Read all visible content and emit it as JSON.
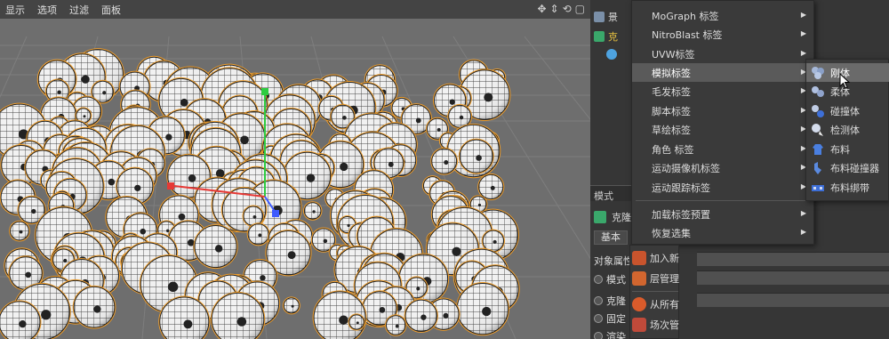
{
  "viewport": {
    "menu": [
      "显示",
      "选项",
      "过滤",
      "面板"
    ],
    "nav_icons": [
      "move-icon",
      "move-vertical-icon",
      "rotate-icon",
      "maximize-icon"
    ]
  },
  "object_manager": {
    "rows": [
      {
        "label": "景",
        "icon": "null-object-icon"
      },
      {
        "label": "克",
        "icon": "cloner-icon"
      },
      {
        "label": "",
        "icon": "sphere-icon"
      }
    ]
  },
  "attributes": {
    "title": "模式",
    "object_label": "克隆",
    "tab_basic": "基本",
    "section": "对象属性",
    "radio_rows": [
      "模式",
      "克隆",
      "固定",
      "渲染"
    ]
  },
  "tag_menu": {
    "items": [
      {
        "label": "MoGraph 标签",
        "submenu": true
      },
      {
        "label": "NitroBlast 标签",
        "submenu": true
      },
      {
        "label": "UVW标签",
        "submenu": true
      },
      {
        "label": "模拟标签",
        "submenu": true,
        "highlighted": true
      },
      {
        "label": "毛发标签",
        "submenu": true
      },
      {
        "label": "脚本标签",
        "submenu": true
      },
      {
        "label": "草绘标签",
        "submenu": true
      },
      {
        "label": "角色 标签",
        "submenu": true
      },
      {
        "label": "运动摄像机标签",
        "submenu": true
      },
      {
        "label": "运动跟踪标签",
        "submenu": true
      },
      {
        "label": "加载标签预置",
        "submenu": true
      },
      {
        "label": "恢复选集",
        "submenu": true
      }
    ]
  },
  "lower_menu": {
    "items": [
      {
        "label": "加入新",
        "icon": "add-layer-icon"
      },
      {
        "label": "层管理",
        "icon": "layer-manager-icon"
      },
      {
        "label": "从所有",
        "icon": "remove-from-all-icon"
      },
      {
        "label": "场次管",
        "icon": "takes-manager-icon"
      }
    ]
  },
  "simulation_submenu": {
    "items": [
      {
        "label": "刚体",
        "icon": "rigid-body-icon",
        "highlighted": true
      },
      {
        "label": "柔体",
        "icon": "soft-body-icon"
      },
      {
        "label": "碰撞体",
        "icon": "collider-body-icon"
      },
      {
        "label": "检测体",
        "icon": "ghost-icon"
      },
      {
        "label": "布料",
        "icon": "cloth-icon"
      },
      {
        "label": "布料碰撞器",
        "icon": "cloth-collider-icon"
      },
      {
        "label": "布料绑带",
        "icon": "cloth-belt-icon"
      }
    ]
  },
  "colors": {
    "viewport_bg": "#6e6e6e",
    "selection_outline": "#f0a030",
    "menu_bg": "#3a3a3a",
    "menu_highlight": "#5a5a5a"
  }
}
